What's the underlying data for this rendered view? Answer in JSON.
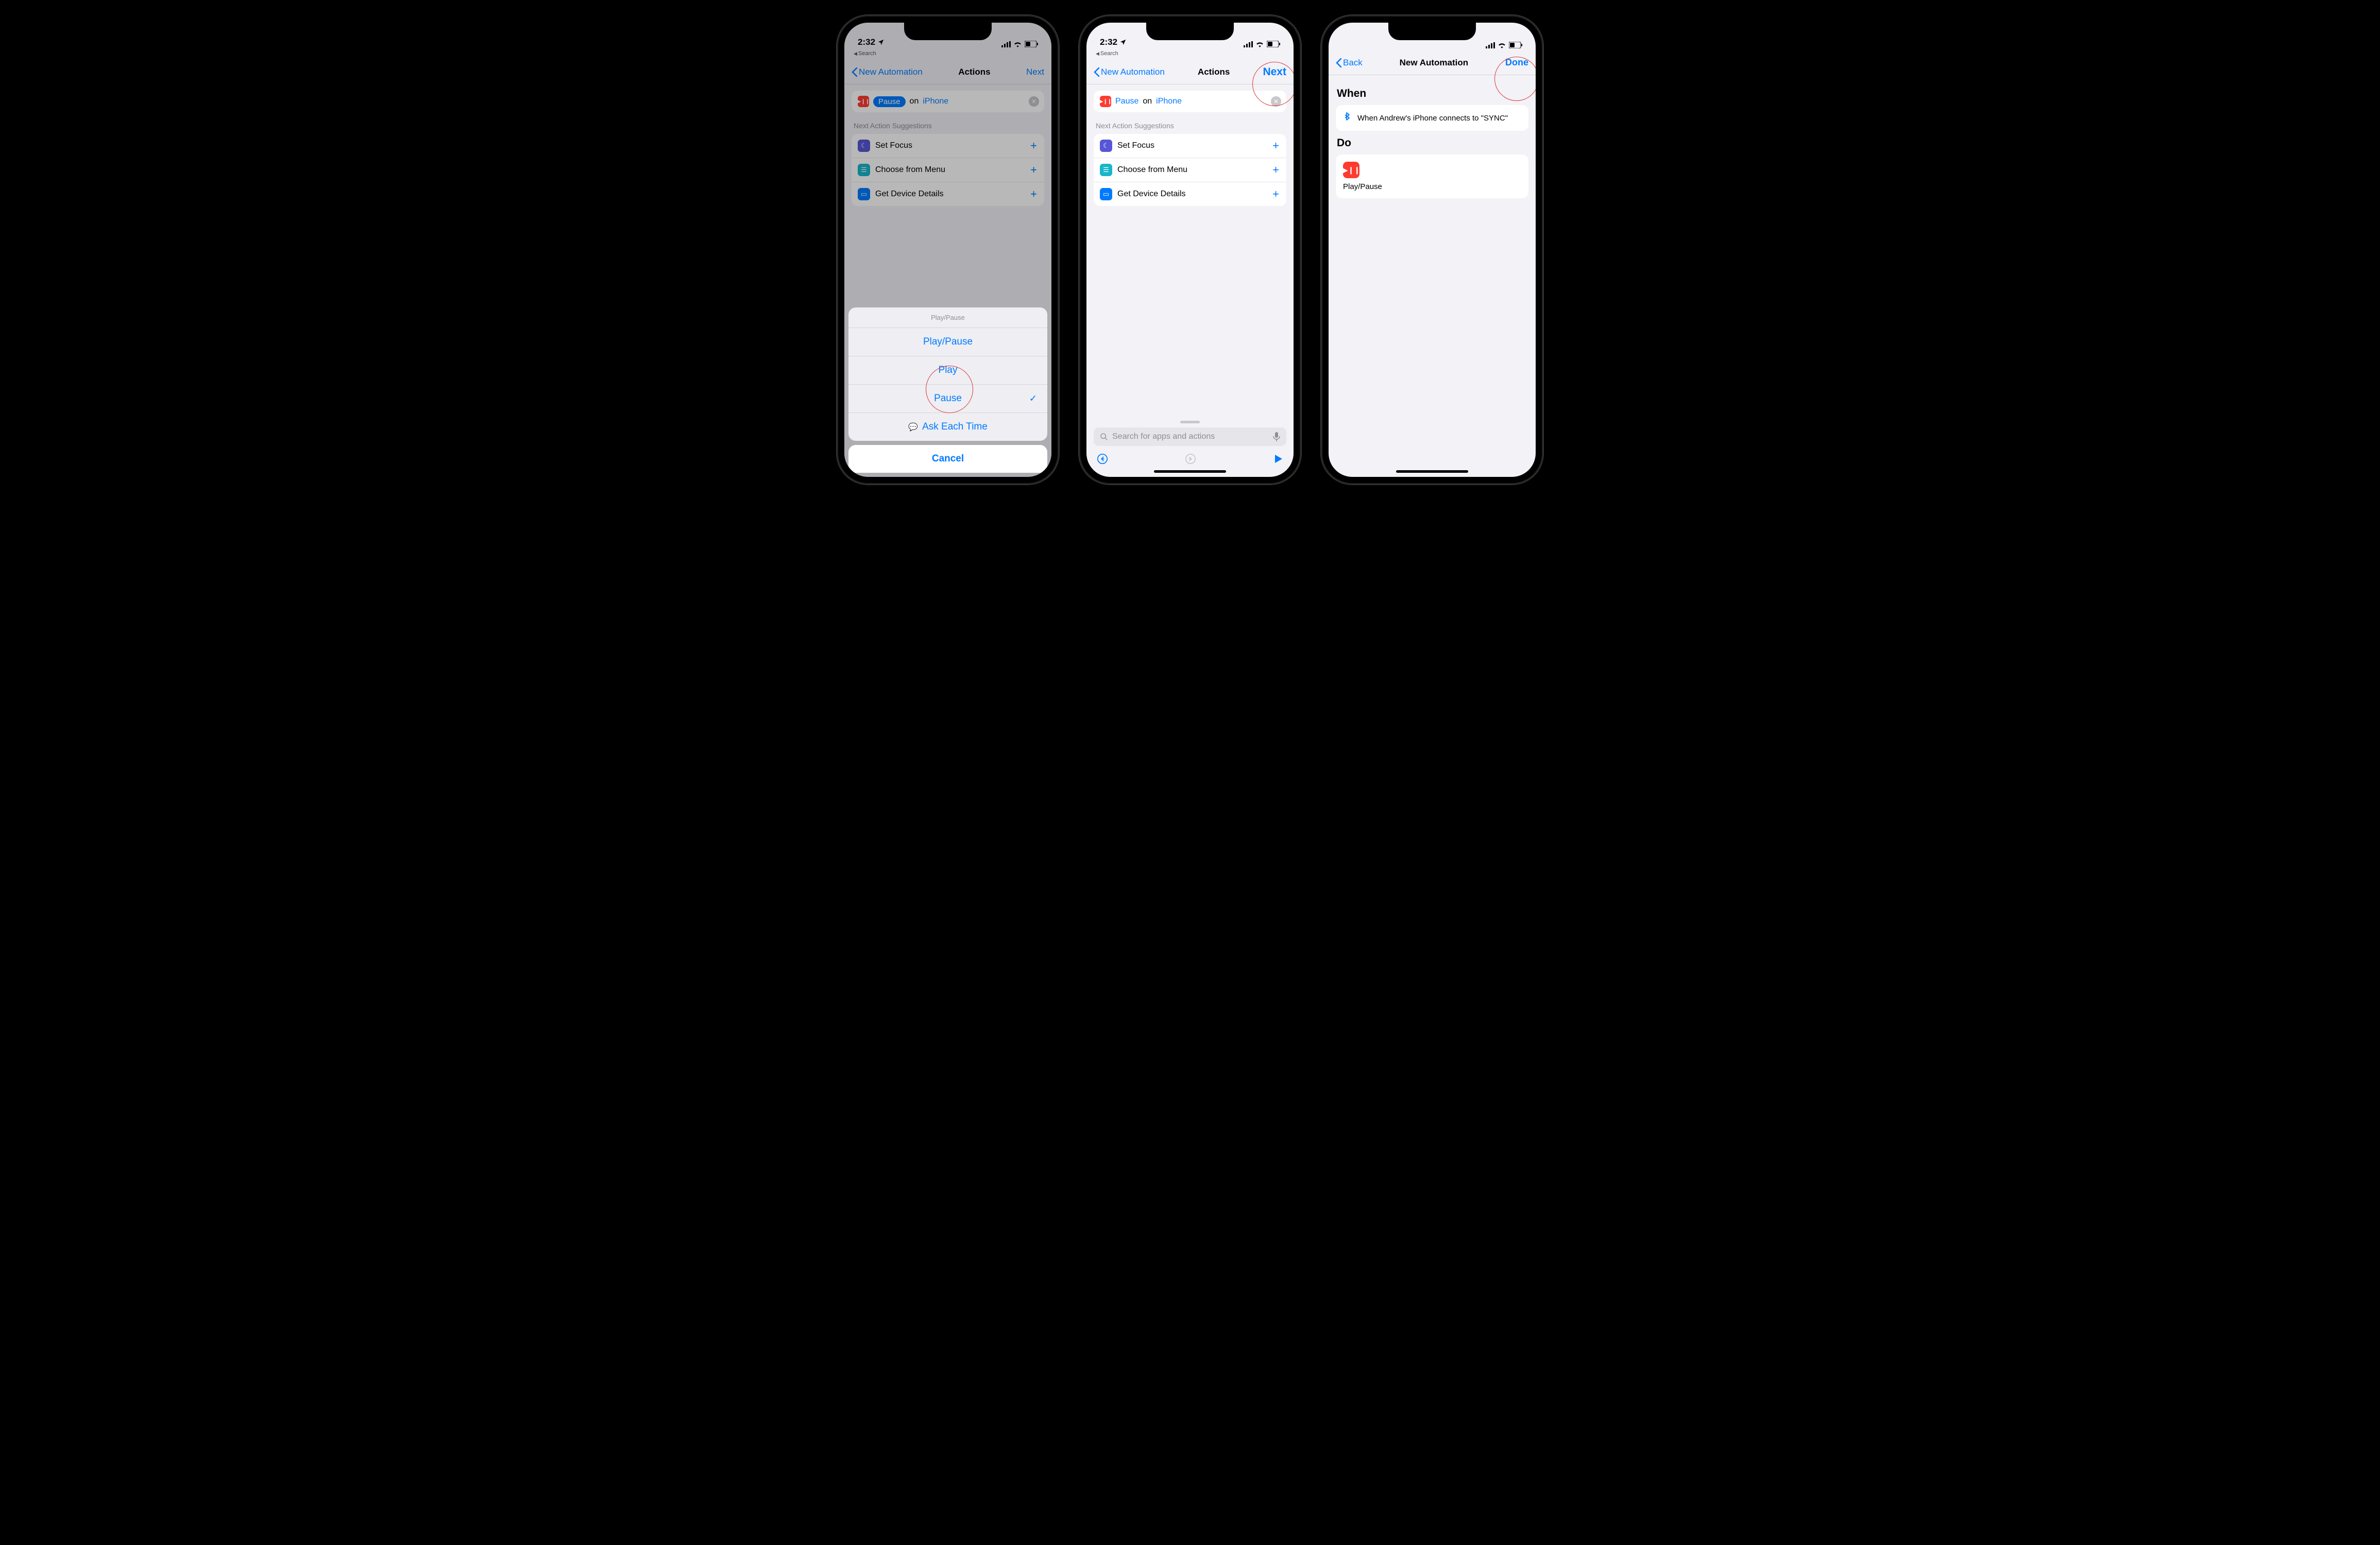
{
  "status": {
    "time": "2:32",
    "breadcrumb": "Search"
  },
  "nav": {
    "back1": "New Automation",
    "title12": "Actions",
    "next": "Next",
    "back3": "Back",
    "title3": "New Automation",
    "done": "Done"
  },
  "action_row": {
    "pause": "Pause",
    "on": "on",
    "iphone": "iPhone"
  },
  "suggestions_label": "Next Action Suggestions",
  "suggestions": [
    {
      "label": "Set Focus"
    },
    {
      "label": "Choose from Menu"
    },
    {
      "label": "Get Device Details"
    }
  ],
  "sheet": {
    "header": "Play/Pause",
    "opt1": "Play/Pause",
    "opt2": "Play",
    "opt3": "Pause",
    "opt4": "Ask Each Time",
    "cancel": "Cancel"
  },
  "search_placeholder": "Search for apps and actions",
  "s3": {
    "when": "When",
    "when_text": "When Andrew's iPhone connects to \"SYNC\"",
    "do": "Do",
    "do_label": "Play/Pause"
  }
}
